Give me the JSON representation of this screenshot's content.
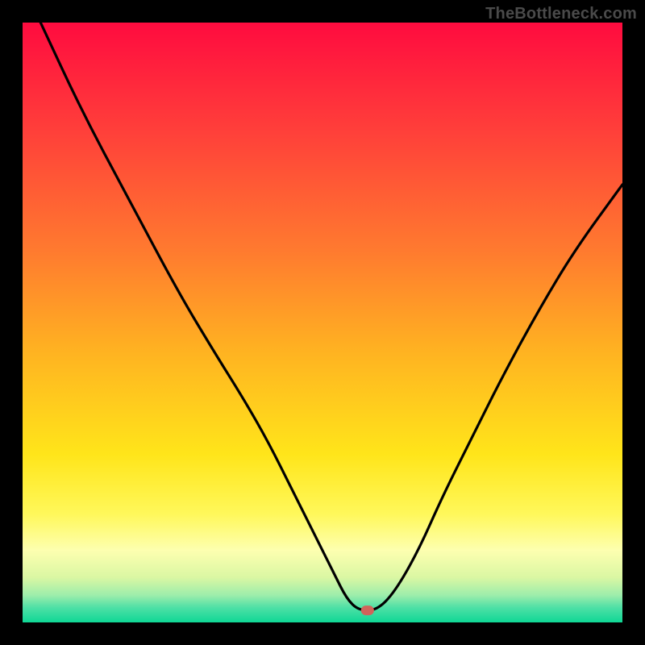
{
  "watermark": "TheBottleneck.com",
  "chart_data": {
    "type": "line",
    "title": "",
    "xlabel": "",
    "ylabel": "",
    "xlim": [
      0,
      100
    ],
    "ylim": [
      0,
      100
    ],
    "series": [
      {
        "name": "curve",
        "x": [
          3,
          10,
          18,
          26,
          32,
          37,
          41,
          45,
          49,
          52,
          54,
          56,
          59,
          62,
          66,
          70,
          75,
          80,
          86,
          92,
          100
        ],
        "values": [
          100,
          85,
          70,
          55,
          45,
          37,
          30,
          22,
          14,
          8,
          4,
          2,
          2,
          5,
          12,
          21,
          31,
          41,
          52,
          62,
          73
        ]
      }
    ],
    "marker": {
      "x": 57.5,
      "y": 2,
      "color": "#d1635a",
      "radius": 7
    },
    "gradient_stops": [
      {
        "offset": 0.0,
        "color": "#ff0b3f"
      },
      {
        "offset": 0.18,
        "color": "#ff3f3a"
      },
      {
        "offset": 0.38,
        "color": "#ff7a2f"
      },
      {
        "offset": 0.55,
        "color": "#ffb321"
      },
      {
        "offset": 0.72,
        "color": "#ffe51a"
      },
      {
        "offset": 0.82,
        "color": "#fff85b"
      },
      {
        "offset": 0.88,
        "color": "#fdffb0"
      },
      {
        "offset": 0.925,
        "color": "#daf7a3"
      },
      {
        "offset": 0.955,
        "color": "#9cedab"
      },
      {
        "offset": 0.975,
        "color": "#4fe0a6"
      },
      {
        "offset": 1.0,
        "color": "#0fd795"
      }
    ]
  }
}
